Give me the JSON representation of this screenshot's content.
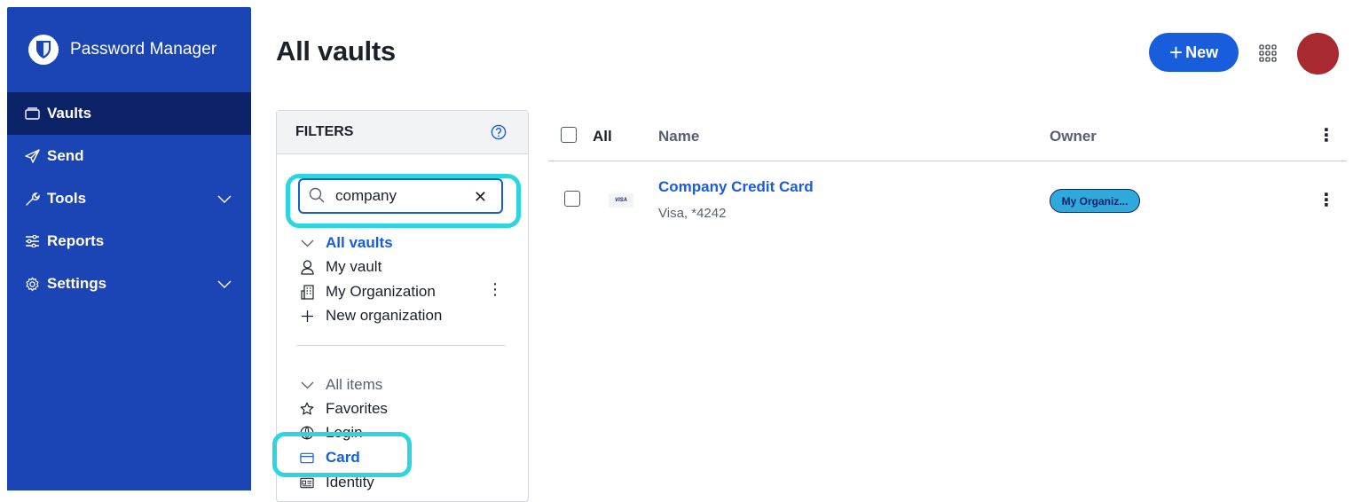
{
  "sidebar": {
    "brand": "Password Manager",
    "items": [
      {
        "label": "Vaults",
        "icon": "vault-icon"
      },
      {
        "label": "Send",
        "icon": "send-icon"
      },
      {
        "label": "Tools",
        "icon": "wrench-icon"
      },
      {
        "label": "Reports",
        "icon": "sliders-icon"
      },
      {
        "label": "Settings",
        "icon": "gear-icon"
      }
    ],
    "bg_color": "#1b45b4",
    "active_color": "#0b2266"
  },
  "header": {
    "title": "All vaults",
    "new_label": "New"
  },
  "filters": {
    "title": "FILTERS",
    "search_value": "company",
    "vaults": [
      {
        "label": "All vaults"
      },
      {
        "label": "My vault"
      },
      {
        "label": "My Organization"
      },
      {
        "label": "New organization"
      }
    ],
    "types": [
      {
        "label": "All items"
      },
      {
        "label": "Favorites"
      },
      {
        "label": "Login"
      },
      {
        "label": "Card"
      },
      {
        "label": "Identity"
      }
    ]
  },
  "table": {
    "all_label": "All",
    "col_name": "Name",
    "col_owner": "Owner",
    "rows": [
      {
        "name": "Company Credit Card",
        "sub": "Visa, *4242",
        "brand": "VISA",
        "owner": "My Organiz..."
      }
    ]
  },
  "colors": {
    "accent": "#175ddc",
    "highlight": "#2ed4de",
    "badge": "#2fa9dc",
    "avatar": "#a8292f"
  }
}
